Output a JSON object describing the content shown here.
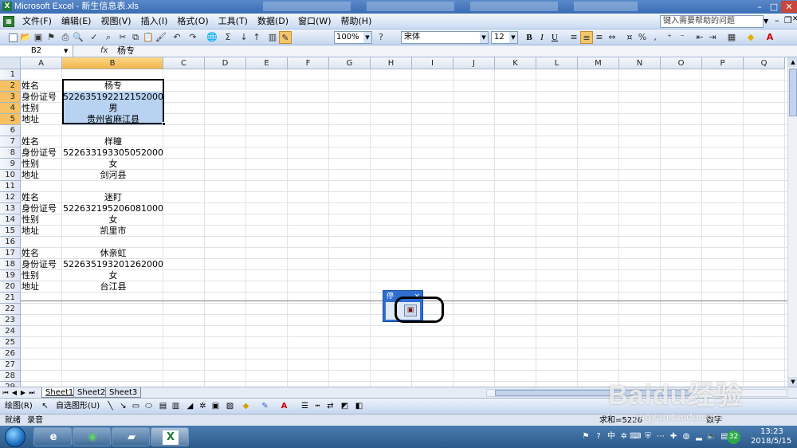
{
  "window": {
    "title": "Microsoft Excel - 新生信息表.xls",
    "controls": [
      "–",
      "□",
      "✕"
    ]
  },
  "menu": {
    "items": [
      "文件(F)",
      "编辑(E)",
      "视图(V)",
      "插入(I)",
      "格式(O)",
      "工具(T)",
      "数据(D)",
      "窗口(W)",
      "帮助(H)"
    ],
    "help_placeholder": "键入需要帮助的问题"
  },
  "toolbar": {
    "zoom": "100%",
    "font": "宋体",
    "font_size": "12",
    "bold": "B",
    "italic": "I",
    "underline": "U"
  },
  "formula_bar": {
    "name_box": "B2",
    "fx": "fx",
    "content": "杨专"
  },
  "grid": {
    "columns": [
      "A",
      "B",
      "C",
      "D",
      "E",
      "F",
      "G",
      "H",
      "I",
      "J",
      "K",
      "L",
      "M",
      "N",
      "O",
      "P",
      "Q"
    ],
    "rows": [
      "1",
      "2",
      "3",
      "4",
      "5",
      "6",
      "7",
      "8",
      "9",
      "10",
      "11",
      "12",
      "13",
      "14",
      "15",
      "16",
      "17",
      "18",
      "19",
      "20",
      "21",
      "22",
      "23",
      "24",
      "25",
      "26",
      "27",
      "28",
      "29"
    ],
    "records": [
      {
        "label_name": "姓名",
        "name": "杨专",
        "label_id": "身份证号",
        "id": "522635192212152000",
        "label_gender": "性别",
        "gender": "男",
        "label_address": "地址",
        "address": "贵州省麻江县"
      },
      {
        "label_name": "姓名",
        "name": "样瞳",
        "label_id": "身份证号",
        "id": "522633193305052000",
        "label_gender": "性别",
        "gender": "女",
        "label_address": "地址",
        "address": "剑河县"
      },
      {
        "label_name": "姓名",
        "name": "迷盯",
        "label_id": "身份证号",
        "id": "522632195206081000",
        "label_gender": "性别",
        "gender": "女",
        "label_address": "地址",
        "address": "凯里市"
      },
      {
        "label_name": "姓名",
        "name": "休亲虹",
        "label_id": "身份证号",
        "id": "522635193201262000",
        "label_gender": "性别",
        "gender": "女",
        "label_address": "地址",
        "address": "台江县"
      }
    ]
  },
  "mini_toolbar": {
    "title": "停",
    "close": "×"
  },
  "sheets": {
    "tabs": [
      "Sheet1",
      "Sheet2",
      "Sheet3"
    ],
    "active": "Sheet1"
  },
  "draw_toolbar": {
    "draw_label": "绘图(R)",
    "autoshape_label": "自选图形(U)"
  },
  "status": {
    "left_1": "就绪",
    "left_2": "录音",
    "right_1": "求和=5226",
    "right_2": "数字"
  },
  "taskbar": {
    "time": "13:23",
    "date": "2018/5/15",
    "badge": "32",
    "ime": "中"
  },
  "watermark": {
    "text": "Baidu经验",
    "sub": "jingyan.baidu.com"
  }
}
